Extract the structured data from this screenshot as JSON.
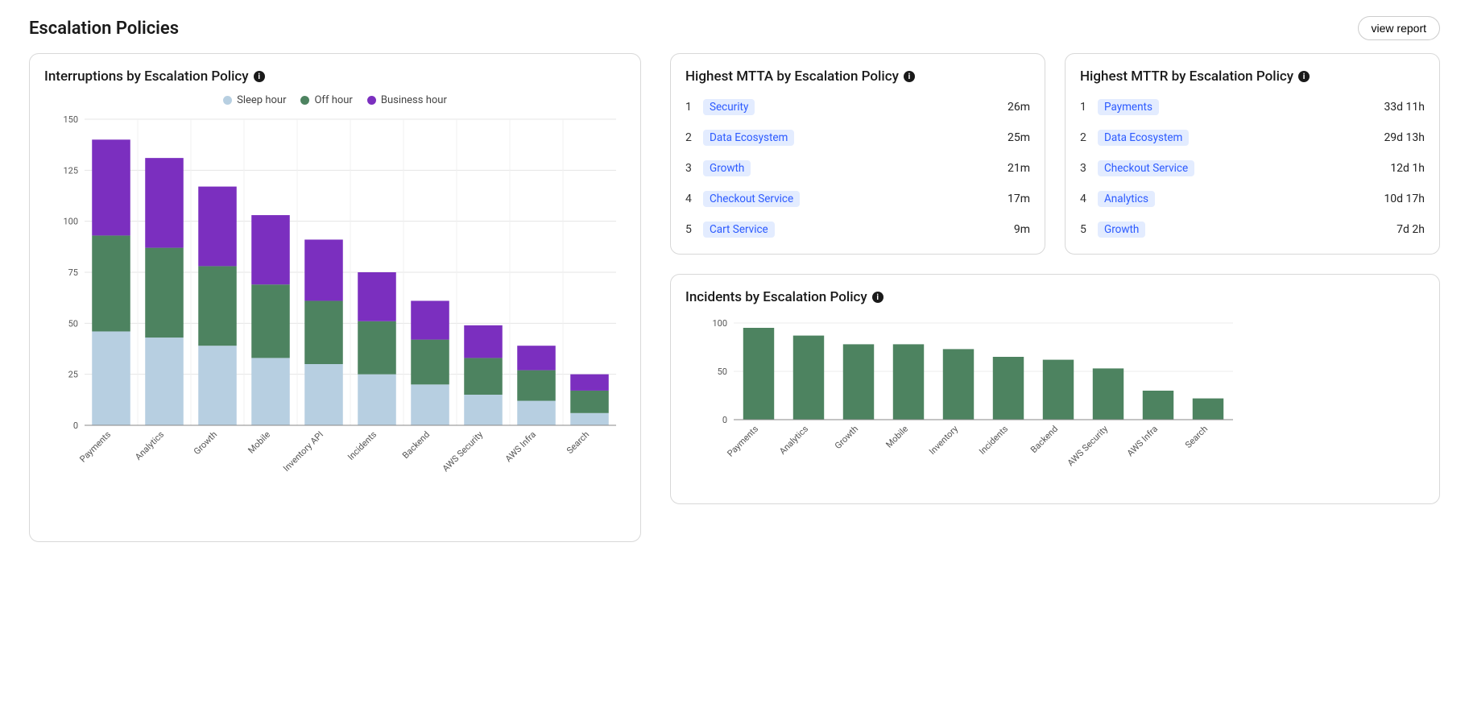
{
  "header": {
    "title": "Escalation Policies",
    "view_report": "view report"
  },
  "interruptions": {
    "title": "Interruptions by Escalation Policy",
    "legend": {
      "sleep": "Sleep hour",
      "off": "Off hour",
      "business": "Business hour"
    }
  },
  "mtta": {
    "title": "Highest MTTA by Escalation Policy"
  },
  "mttr": {
    "title": "Highest MTTR by Escalation Policy"
  },
  "incidents": {
    "title": "Incidents by Escalation Policy"
  },
  "colors": {
    "sleep": "#b7cfe1",
    "off": "#4d8360",
    "business": "#7b2fbf",
    "incident": "#4d8360"
  },
  "chart_data": [
    {
      "id": "interruptions",
      "type": "bar",
      "stacked": true,
      "title": "Interruptions by Escalation Policy",
      "ylabel": "",
      "ylim": [
        0,
        150
      ],
      "yticks": [
        0,
        25,
        50,
        75,
        100,
        125,
        150
      ],
      "categories": [
        "Payments",
        "Analytics",
        "Growth",
        "Mobile",
        "Inventory API",
        "Incidents",
        "Backend",
        "AWS Security",
        "AWS Infra",
        "Search"
      ],
      "series": [
        {
          "name": "Sleep hour",
          "values": [
            46,
            43,
            39,
            33,
            30,
            25,
            20,
            15,
            12,
            6
          ]
        },
        {
          "name": "Off hour",
          "values": [
            47,
            44,
            39,
            36,
            31,
            26,
            22,
            18,
            15,
            11
          ]
        },
        {
          "name": "Business hour",
          "values": [
            47,
            44,
            39,
            34,
            30,
            24,
            19,
            16,
            12,
            8
          ]
        }
      ],
      "legend_position": "top"
    },
    {
      "id": "incidents",
      "type": "bar",
      "stacked": false,
      "title": "Incidents by Escalation Policy",
      "ylabel": "",
      "ylim": [
        0,
        100
      ],
      "yticks": [
        0,
        50,
        100
      ],
      "categories": [
        "Payments",
        "Analytics",
        "Growth",
        "Mobile",
        "Inventory",
        "Incidents",
        "Backend",
        "AWS Security",
        "AWS Infra",
        "Search"
      ],
      "series": [
        {
          "name": "Incidents",
          "values": [
            95,
            87,
            78,
            78,
            73,
            65,
            62,
            53,
            30,
            22
          ]
        }
      ]
    }
  ],
  "mtta_rows": [
    {
      "rank": "1",
      "name": "Security",
      "value": "26m"
    },
    {
      "rank": "2",
      "name": "Data Ecosystem",
      "value": "25m"
    },
    {
      "rank": "3",
      "name": "Growth",
      "value": "21m"
    },
    {
      "rank": "4",
      "name": "Checkout Service",
      "value": "17m"
    },
    {
      "rank": "5",
      "name": "Cart Service",
      "value": "9m"
    }
  ],
  "mttr_rows": [
    {
      "rank": "1",
      "name": "Payments",
      "value": "33d 11h"
    },
    {
      "rank": "2",
      "name": "Data Ecosystem",
      "value": "29d 13h"
    },
    {
      "rank": "3",
      "name": "Checkout Service",
      "value": "12d 1h"
    },
    {
      "rank": "4",
      "name": "Analytics",
      "value": "10d 17h"
    },
    {
      "rank": "5",
      "name": "Growth",
      "value": "7d 2h"
    }
  ]
}
